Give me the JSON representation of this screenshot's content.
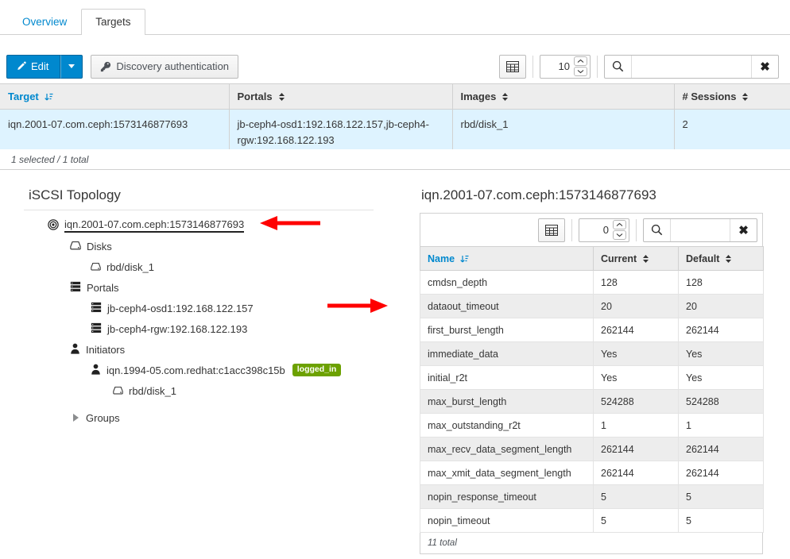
{
  "tabs": [
    {
      "label": "Overview",
      "active": false
    },
    {
      "label": "Targets",
      "active": true
    }
  ],
  "toolbar": {
    "edit_label": "Edit",
    "edit_icon": "pencil-icon",
    "caret_icon": "caret-down-icon",
    "discovery_label": "Discovery authentication",
    "discovery_icon": "key-icon",
    "table_view_icon": "table-grid-icon",
    "page_size": "10",
    "search_icon": "search-icon",
    "search_value": "",
    "search_placeholder": "",
    "clear_icon": "close-icon",
    "clear_label": "✖"
  },
  "main_table": {
    "columns": [
      {
        "label": "Target",
        "sort": "sort-asc-icon"
      },
      {
        "label": "Portals",
        "sort": "sort-both-icon"
      },
      {
        "label": "Images",
        "sort": "sort-both-icon"
      },
      {
        "label": "# Sessions",
        "sort": "sort-both-icon"
      }
    ],
    "rows": [
      {
        "target": "iqn.2001-07.com.ceph:1573146877693",
        "portals": "jb-ceph4-osd1:192.168.122.157,jb-ceph4-rgw:192.168.122.193",
        "images": "rbd/disk_1",
        "sessions": "2",
        "selected": true
      }
    ],
    "footer": "1 selected / 1 total"
  },
  "topology": {
    "title": "iSCSI Topology",
    "nodes": [
      {
        "level": "root",
        "icon": "target-bullseye-icon",
        "label": "iqn.2001-07.com.ceph:1573146877693",
        "underline": true
      },
      {
        "level": "lvl1",
        "icon": "disk-icon",
        "label": "Disks"
      },
      {
        "level": "lvl2",
        "icon": "disk-icon",
        "label": "rbd/disk_1"
      },
      {
        "level": "lvl1",
        "icon": "server-stack-icon",
        "label": "Portals"
      },
      {
        "level": "lvl2",
        "icon": "server-stack-icon",
        "label": "jb-ceph4-osd1:192.168.122.157"
      },
      {
        "level": "lvl2",
        "icon": "server-stack-icon",
        "label": "jb-ceph4-rgw:192.168.122.193"
      },
      {
        "level": "lvl1",
        "icon": "user-icon",
        "label": "Initiators"
      },
      {
        "level": "lvl2",
        "icon": "user-icon",
        "label": "iqn.1994-05.com.redhat:c1acc398c15b",
        "badge": "logged_in"
      },
      {
        "level": "lvl3",
        "icon": "disk-icon",
        "label": "rbd/disk_1"
      },
      {
        "level": "groups",
        "icon": "triangle-right-icon",
        "label": "Groups"
      }
    ],
    "annotations": [
      {
        "name": "arrow-pointing-to-target-node",
        "direction": "left",
        "color": "#ff0000"
      },
      {
        "name": "arrow-pointing-to-details-panel",
        "direction": "right",
        "color": "#ff0000"
      }
    ]
  },
  "details": {
    "title": "iqn.2001-07.com.ceph:1573146877693",
    "toolbar": {
      "table_view_icon": "table-grid-icon",
      "page_size": "0",
      "search_icon": "search-icon",
      "search_value": "",
      "clear_icon": "close-icon",
      "clear_label": "✖"
    },
    "columns": [
      {
        "label": "Name",
        "sort": "sort-asc-icon"
      },
      {
        "label": "Current",
        "sort": "sort-both-icon"
      },
      {
        "label": "Default",
        "sort": "sort-both-icon"
      }
    ],
    "rows": [
      {
        "name": "cmdsn_depth",
        "current": "128",
        "default": "128"
      },
      {
        "name": "dataout_timeout",
        "current": "20",
        "default": "20"
      },
      {
        "name": "first_burst_length",
        "current": "262144",
        "default": "262144"
      },
      {
        "name": "immediate_data",
        "current": "Yes",
        "default": "Yes"
      },
      {
        "name": "initial_r2t",
        "current": "Yes",
        "default": "Yes"
      },
      {
        "name": "max_burst_length",
        "current": "524288",
        "default": "524288"
      },
      {
        "name": "max_outstanding_r2t",
        "current": "1",
        "default": "1"
      },
      {
        "name": "max_recv_data_segment_length",
        "current": "262144",
        "default": "262144"
      },
      {
        "name": "max_xmit_data_segment_length",
        "current": "262144",
        "default": "262144"
      },
      {
        "name": "nopin_response_timeout",
        "current": "5",
        "default": "5"
      },
      {
        "name": "nopin_timeout",
        "current": "5",
        "default": "5"
      }
    ],
    "footer": "11 total"
  },
  "colors": {
    "link": "#0088ce",
    "primary_button": "#0088ce",
    "selected_row": "#def3ff",
    "badge_green": "#6ca100",
    "arrow_red": "#ff0000"
  }
}
